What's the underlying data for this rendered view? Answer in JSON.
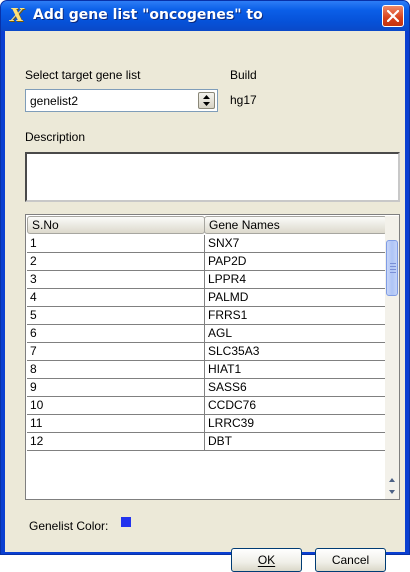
{
  "window": {
    "icon_glyph": "X",
    "title": "Add gene list \"oncogenes\" to",
    "accent": "#0a49c8"
  },
  "form": {
    "target_label": "Select target gene list",
    "target_value": "genelist2",
    "build_label": "Build",
    "build_value": "hg17",
    "description_label": "Description",
    "description_value": ""
  },
  "table": {
    "headers": [
      "S.No",
      "Gene Names"
    ],
    "rows": [
      [
        "1",
        "SNX7"
      ],
      [
        "2",
        "PAP2D"
      ],
      [
        "3",
        "LPPR4"
      ],
      [
        "4",
        "PALMD"
      ],
      [
        "5",
        "FRRS1"
      ],
      [
        "6",
        "AGL"
      ],
      [
        "7",
        "SLC35A3"
      ],
      [
        "8",
        "HIAT1"
      ],
      [
        "9",
        "SASS6"
      ],
      [
        "10",
        "CCDC76"
      ],
      [
        "11",
        "LRRC39"
      ],
      [
        "12",
        "DBT"
      ]
    ]
  },
  "genelist_color": {
    "label": "Genelist Color:",
    "color": "#2233ee"
  },
  "buttons": {
    "ok": "OK",
    "cancel": "Cancel"
  },
  "icons": {
    "app": "app-x-icon",
    "close": "close-icon",
    "spin": "spinner-arrows-icon"
  }
}
